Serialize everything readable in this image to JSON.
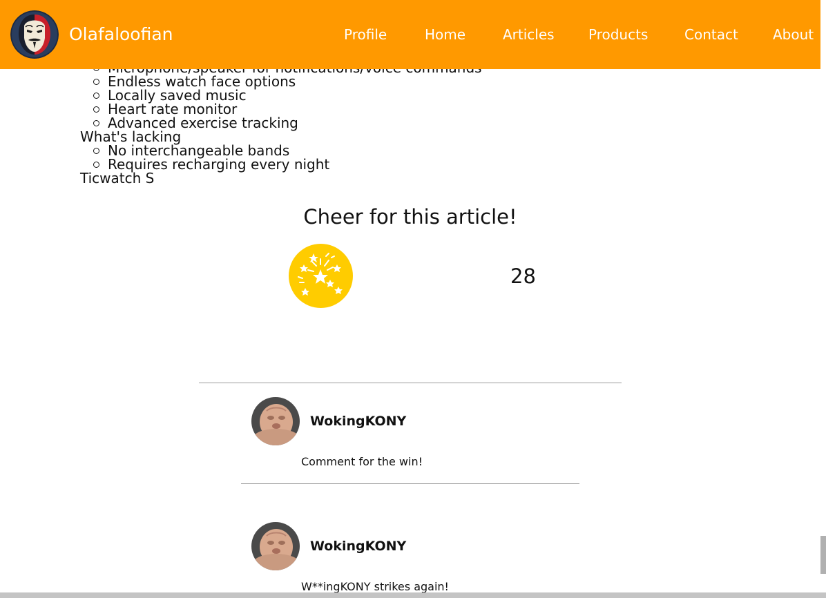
{
  "header": {
    "site_name": "Olafaloofian",
    "nav": [
      "Profile",
      "Home",
      "Articles",
      "Products",
      "Contact",
      "About"
    ]
  },
  "article": {
    "features_partial": [
      "Microphone/speaker for notifications/voice commands",
      "Endless watch face options",
      "Locally saved music",
      "Heart rate monitor",
      "Advanced exercise tracking"
    ],
    "lacking_heading": "What's lacking",
    "lacking": [
      "No interchangeable bands",
      "Requires recharging every night"
    ],
    "next_heading": "Ticwatch S"
  },
  "cheer": {
    "title": "Cheer for this article!",
    "icon": "fireworks-icon",
    "count": "28"
  },
  "comments": [
    {
      "author": "WokingKONY",
      "text": "Comment for the win!"
    },
    {
      "author": "WokingKONY",
      "text": "W**ingKONY strikes again!"
    }
  ],
  "colors": {
    "nav_bg": "#ff9900",
    "cheer_button": "#ffcc00",
    "nav_text": "#ffffff"
  }
}
